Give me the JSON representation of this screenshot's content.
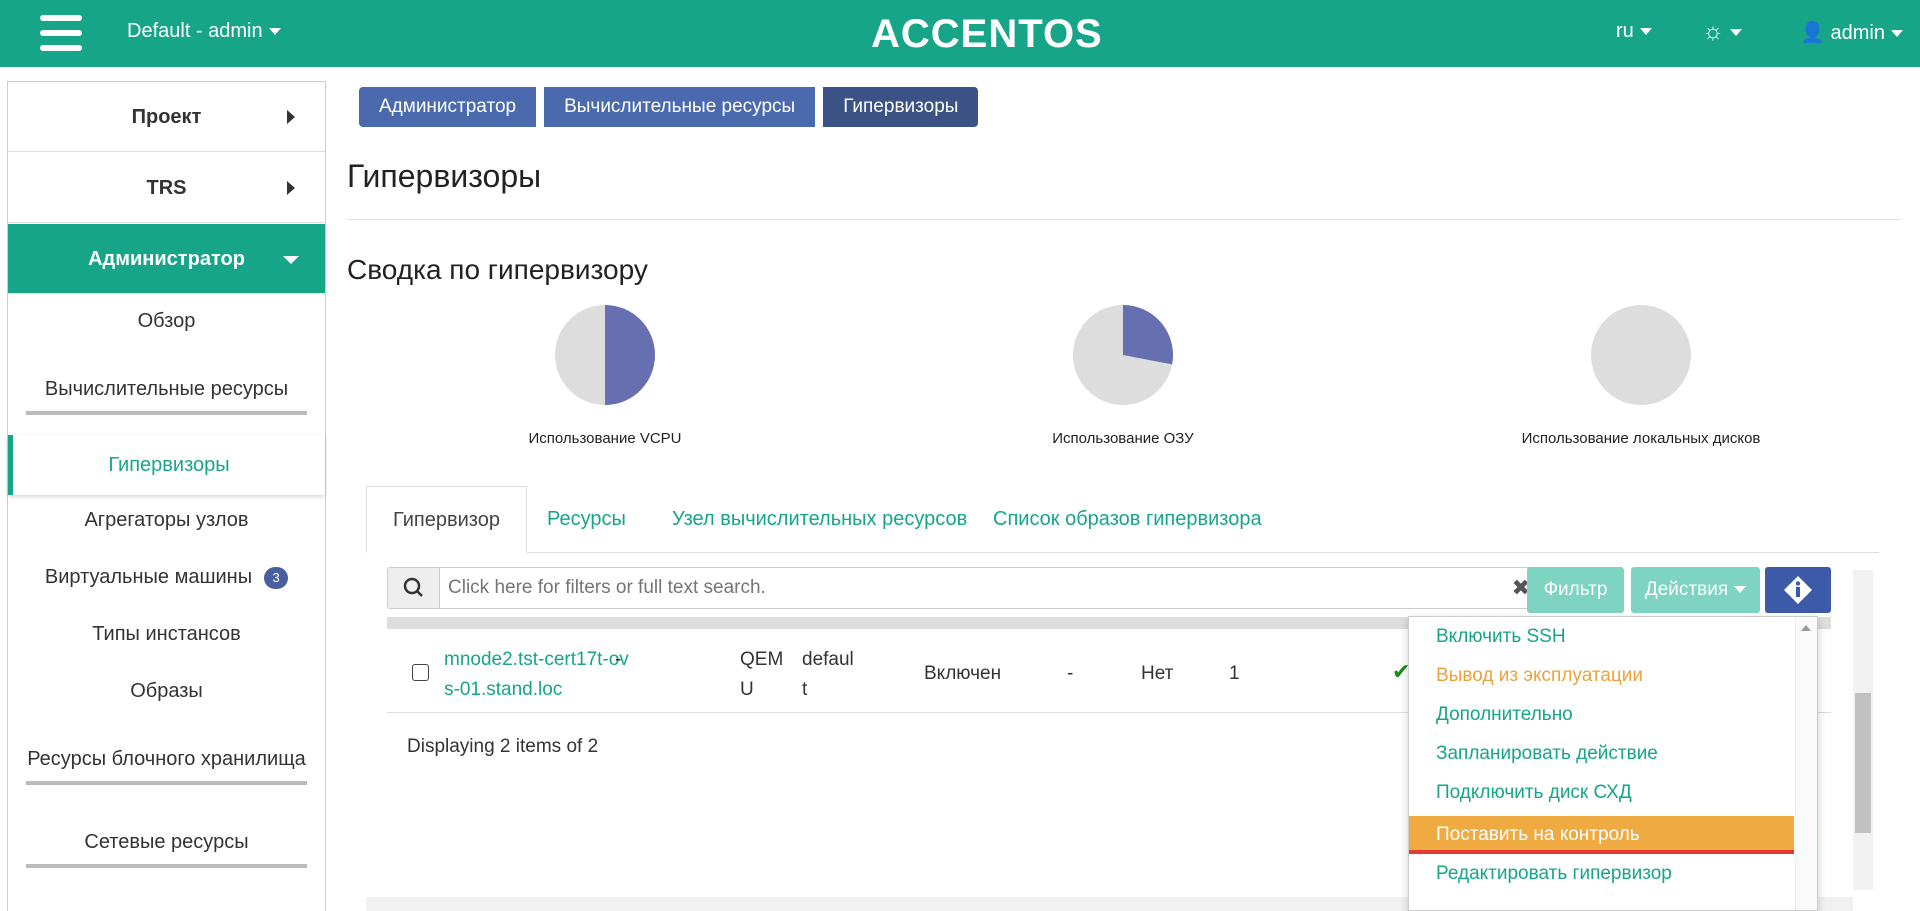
{
  "header": {
    "project_selector": "Default - admin",
    "logo": "ACCENTOS",
    "language": "ru",
    "user": "admin"
  },
  "sidebar": {
    "sections": [
      "Проект",
      "TRS",
      "Администратор"
    ],
    "items": {
      "overview": "Обзор",
      "compute": "Вычислительные ресурсы",
      "hypervisors": "Гипервизоры",
      "aggregates": "Агрегаторы узлов",
      "vms": "Виртуальные машины",
      "vms_badge": "3",
      "flavors": "Типы инстансов",
      "images": "Образы",
      "block_storage": "Ресурсы блочного хранилища",
      "network": "Сетевые ресурсы"
    }
  },
  "breadcrumb": [
    "Администратор",
    "Вычислительные ресурсы",
    "Гипервизоры"
  ],
  "page_title": "Гипервизоры",
  "summary": {
    "title": "Сводка по гипервизору",
    "charts": [
      {
        "label": "Использование VCPU",
        "used_fraction": 0.5
      },
      {
        "label": "Использование ОЗУ",
        "used_fraction": 0.28
      },
      {
        "label": "Использование локальных дисков",
        "used_fraction": 0
      }
    ],
    "colors": {
      "used": "#6670b0",
      "free": "#dddddd"
    }
  },
  "tabs": [
    "Гипервизор",
    "Ресурсы",
    "Узел вычислительных ресурсов",
    "Список образов гипервизора"
  ],
  "table": {
    "search_placeholder": "Click here for filters or full text search.",
    "filter_button": "Фильтр",
    "actions_button": "Действия",
    "row": {
      "host_line1": "mnode2.tst-cert17t-ov",
      "host_line2": "s-01.stand.loc",
      "col2": "-",
      "type_line1": "QEM",
      "type_line2": "U",
      "zone_line1": "defaul",
      "zone_line2": "t",
      "status": "Включен",
      "col6": "-",
      "col7": "Нет",
      "col8": "1"
    },
    "displaying": "Displaying 2 items of 2"
  },
  "actions_menu": [
    "Включить SSH",
    "Вывод из эксплуатации",
    "Дополнительно",
    "Запланировать действие",
    "Подключить диск СХД",
    "Поставить на контроль",
    "Редактировать гипервизор"
  ],
  "colors": {
    "accent": "#17a589",
    "breadcrumb": "#4a6aad",
    "highlight": "#efab42",
    "warn": "#e8a33d"
  }
}
